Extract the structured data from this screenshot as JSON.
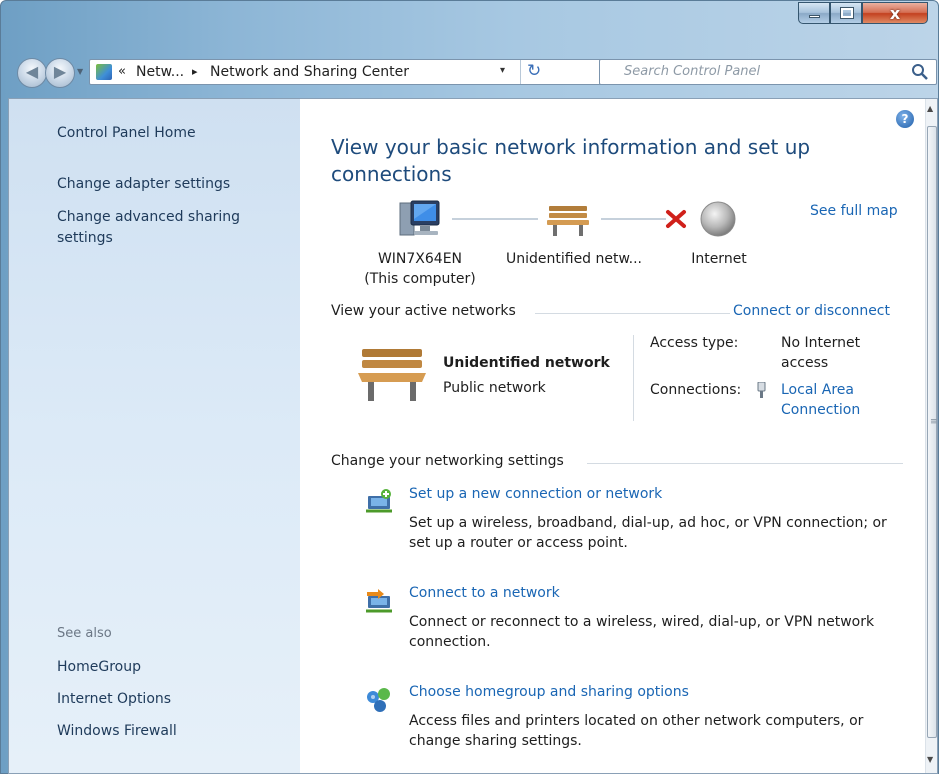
{
  "window": {
    "minimize_label": "–",
    "maximize_label": "□",
    "close_label": "x"
  },
  "address": {
    "overflow": "«",
    "crumbs": [
      "Netw...",
      "Network and Sharing Center"
    ],
    "separator": "▸",
    "dropdown": "▾",
    "refresh": "↻"
  },
  "search": {
    "placeholder": "Search Control Panel"
  },
  "sidebar": {
    "items": [
      {
        "label": "Control Panel Home"
      },
      {
        "label": "Change adapter settings"
      },
      {
        "label": "Change advanced sharing settings"
      }
    ],
    "see_also_label": "See also",
    "see_also": [
      {
        "label": "HomeGroup"
      },
      {
        "label": "Internet Options"
      },
      {
        "label": "Windows Firewall"
      }
    ]
  },
  "main": {
    "help": "?",
    "title": "View your basic network information and set up connections",
    "see_full_map": "See full map",
    "map": {
      "computer_name": "WIN7X64EN",
      "computer_sub": "(This computer)",
      "network": "Unidentified netw...",
      "internet": "Internet"
    },
    "active_networks_heading": "View your active networks",
    "connect_or_disconnect": "Connect or disconnect",
    "active_network": {
      "name": "Unidentified network",
      "type": "Public network",
      "access_type_key": "Access type:",
      "access_type_value": "No Internet access",
      "connections_key": "Connections:",
      "connections_value": "Local Area Connection"
    },
    "change_settings_heading": "Change your networking settings",
    "tasks": [
      {
        "title": "Set up a new connection or network",
        "description": "Set up a wireless, broadband, dial-up, ad hoc, or VPN connection; or set up a router or access point."
      },
      {
        "title": "Connect to a network",
        "description": "Connect or reconnect to a wireless, wired, dial-up, or VPN network connection."
      },
      {
        "title": "Choose homegroup and sharing options",
        "description": "Access files and printers located on other network computers, or change sharing settings."
      }
    ]
  },
  "colors": {
    "link": "#1a66b4",
    "title": "#1e4b7c",
    "sidebar_bg": "#dceaf7",
    "error": "#d0201a"
  }
}
